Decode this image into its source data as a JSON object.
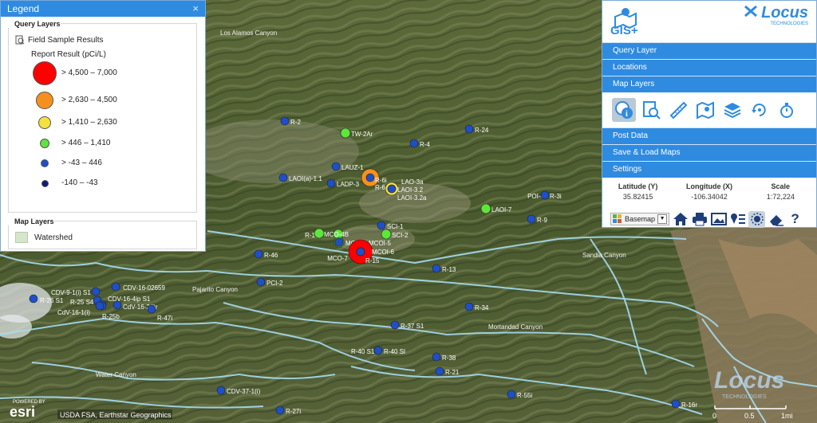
{
  "legend": {
    "title": "Legend",
    "close": "×",
    "query_layers_title": "Query Layers",
    "field_sample": "Field Sample Results",
    "report_result": "Report Result (pCi/L)",
    "items": [
      {
        "label": "> 4,500 – 7,000",
        "color": "#ff0000"
      },
      {
        "label": "> 2,630 – 4,500",
        "color": "#f5901e"
      },
      {
        "label": "> 1,410 – 2,630",
        "color": "#f5e13c"
      },
      {
        "label": "> 446 – 1,410",
        "color": "#5ee63a"
      },
      {
        "label": "> -43 – 446",
        "color": "#1f4fc8"
      },
      {
        "label": "-140 – -43",
        "color": "#0d1a7a"
      }
    ],
    "map_layers_title": "Map Layers",
    "watershed": "Watershed"
  },
  "gis": {
    "app_name": "GIS+",
    "brand": "Locus",
    "brand_sub": "TECHNOLOGIES",
    "menu": [
      "Query Layer",
      "Locations",
      "Map Layers",
      "Post Data",
      "Save & Load Maps",
      "Settings"
    ],
    "tool_icons": [
      "identify-icon",
      "search-list-icon",
      "measure-icon",
      "map-layers-icon",
      "layers-icon",
      "refresh-icon",
      "timer-icon"
    ],
    "lat_label": "Latitude (Y)",
    "lat_value": "35.82415",
    "lon_label": "Longitude (X)",
    "lon_value": "-106.34042",
    "scale_label": "Scale",
    "scale_value": "1:72,224",
    "basemap_label": "Basemap"
  },
  "map": {
    "place_labels": [
      {
        "text": "Los Alamos Canyon"
      },
      {
        "text": "Pajarito Canyon"
      },
      {
        "text": "Sandia Canyon"
      },
      {
        "text": "Mortandad Canyon"
      },
      {
        "text": "Water Canyon"
      }
    ],
    "markers": [
      {
        "name": "R-2",
        "category": 4
      },
      {
        "name": "TW-2Ar",
        "category": 3
      },
      {
        "name": "R-24",
        "category": 4
      },
      {
        "name": "R-4",
        "category": 4
      },
      {
        "name": "LAUZ-1",
        "category": 4
      },
      {
        "name": "LAOI(a)-1.1",
        "category": 4
      },
      {
        "name": "LADP-3",
        "category": 4
      },
      {
        "name": "R-6i",
        "category": 1
      },
      {
        "name": "R-6",
        "category": 4
      },
      {
        "name": "LAO-3a",
        "category": 2
      },
      {
        "name": "LAOI-3.2",
        "category": 4
      },
      {
        "name": "LAOI-3.2a",
        "category": 4
      },
      {
        "name": "POI-4",
        "category": 4
      },
      {
        "name": "R-3i",
        "category": 4
      },
      {
        "name": "LAOI-7",
        "category": 3
      },
      {
        "name": "R-9",
        "category": 4
      },
      {
        "name": "SCI-1",
        "category": 4
      },
      {
        "name": "SCI-2",
        "category": 3
      },
      {
        "name": "R-1",
        "category": 3
      },
      {
        "name": "MCO-4B",
        "category": 3
      },
      {
        "name": "MCO-6",
        "category": 3
      },
      {
        "name": "MCOI-5",
        "category": 4
      },
      {
        "name": "MCOI-6",
        "category": 0
      },
      {
        "name": "MCO-7",
        "category": 4
      },
      {
        "name": "R-15",
        "category": 4
      },
      {
        "name": "R-46",
        "category": 4
      },
      {
        "name": "R-13",
        "category": 4
      },
      {
        "name": "PCI-2",
        "category": 4
      },
      {
        "name": "CDV-16-02659",
        "category": 4
      },
      {
        "name": "CDV-9-1(i) S1",
        "category": 4
      },
      {
        "name": "R-26 S1",
        "category": 4
      },
      {
        "name": "R-25 S4",
        "category": 4
      },
      {
        "name": "CDV-16-4ip S1",
        "category": 4
      },
      {
        "name": "CdV-16-2(i)r",
        "category": 4
      },
      {
        "name": "CdV-16-1(i)",
        "category": 4
      },
      {
        "name": "R-25b",
        "category": 4
      },
      {
        "name": "R-47i",
        "category": 4
      },
      {
        "name": "R-34",
        "category": 4
      },
      {
        "name": "R-37 S1",
        "category": 4
      },
      {
        "name": "R-40 S1",
        "category": 4
      },
      {
        "name": "R-40 SI",
        "category": 4
      },
      {
        "name": "R-38",
        "category": 4
      },
      {
        "name": "R-21",
        "category": 4
      },
      {
        "name": "CDV-37-1(i)",
        "category": 4
      },
      {
        "name": "R-55i",
        "category": 4
      },
      {
        "name": "R-27i",
        "category": 4
      },
      {
        "name": "R-16r",
        "category": 4
      }
    ]
  },
  "attribution": "USDA FSA, Earthstar Geographics",
  "powered_by": "POWERED BY",
  "esri": "esri",
  "watermark": "Locus",
  "watermark_sub": "TECHNOLOGIES",
  "scalebar": {
    "labels": [
      "0",
      "0.5",
      "1mi"
    ]
  },
  "colors": {
    "accent": "#2f8be0",
    "river": "#9fd6ee"
  }
}
